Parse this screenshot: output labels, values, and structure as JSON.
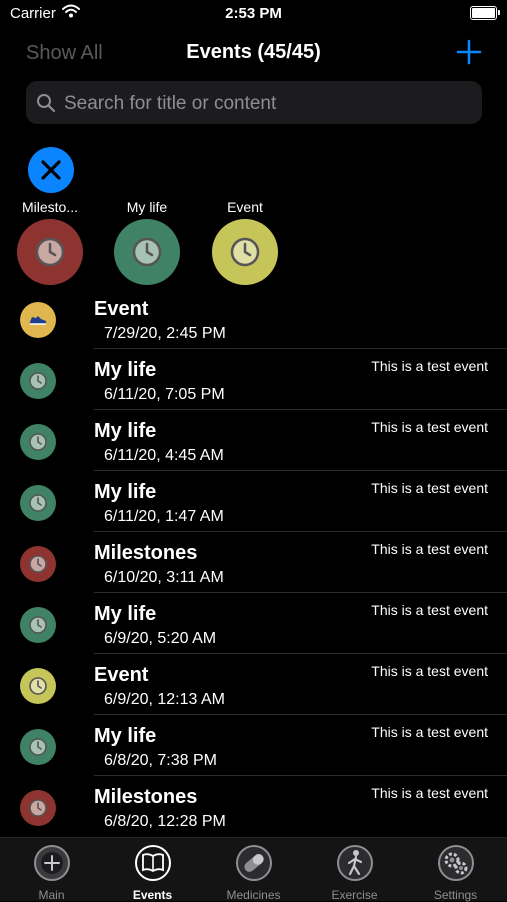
{
  "status_bar": {
    "carrier": "Carrier",
    "time": "2:53 PM"
  },
  "nav": {
    "show_all": "Show All",
    "title": "Events (45/45)",
    "add_icon": "plus-icon"
  },
  "search": {
    "placeholder": "Search for title or content",
    "value": ""
  },
  "colors": {
    "milestones": "#8e3430",
    "my_life": "#3f8265",
    "event": "#c6c559",
    "accent": "#0a84ff"
  },
  "categories": [
    {
      "label": "Milesto...",
      "color": "#8e3430",
      "icon": "clock-icon"
    },
    {
      "label": "My life",
      "color": "#3f8265",
      "icon": "clock-icon"
    },
    {
      "label": "Event",
      "color": "#c6c559",
      "icon": "clock-icon"
    }
  ],
  "events": [
    {
      "title": "Event",
      "date": "7/29/20, 2:45 PM",
      "note": "",
      "color": "#e0b74e",
      "icon": "shoe-icon"
    },
    {
      "title": "My life",
      "date": "6/11/20, 7:05 PM",
      "note": "This is a test event",
      "color": "#3f8265",
      "icon": "clock-icon"
    },
    {
      "title": "My life",
      "date": "6/11/20, 4:45 AM",
      "note": "This is a test event",
      "color": "#3f8265",
      "icon": "clock-icon"
    },
    {
      "title": "My life",
      "date": "6/11/20, 1:47 AM",
      "note": "This is a test event",
      "color": "#3f8265",
      "icon": "clock-icon"
    },
    {
      "title": "Milestones",
      "date": "6/10/20, 3:11 AM",
      "note": "This is a test event",
      "color": "#8e3430",
      "icon": "clock-icon"
    },
    {
      "title": "My life",
      "date": "6/9/20, 5:20 AM",
      "note": "This is a test event",
      "color": "#3f8265",
      "icon": "clock-icon"
    },
    {
      "title": "Event",
      "date": "6/9/20, 12:13 AM",
      "note": "This is a test event",
      "color": "#c6c559",
      "icon": "clock-icon"
    },
    {
      "title": "My life",
      "date": "6/8/20, 7:38 PM",
      "note": "This is a test event",
      "color": "#3f8265",
      "icon": "clock-icon"
    },
    {
      "title": "Milestones",
      "date": "6/8/20, 12:28 PM",
      "note": "This is a test event",
      "color": "#8e3430",
      "icon": "clock-icon"
    }
  ],
  "tabs": [
    {
      "label": "Main",
      "icon": "plus-circle-icon",
      "active": false
    },
    {
      "label": "Events",
      "icon": "book-icon",
      "active": true
    },
    {
      "label": "Medicines",
      "icon": "pill-icon",
      "active": false
    },
    {
      "label": "Exercise",
      "icon": "runner-icon",
      "active": false
    },
    {
      "label": "Settings",
      "icon": "gears-icon",
      "active": false
    }
  ]
}
